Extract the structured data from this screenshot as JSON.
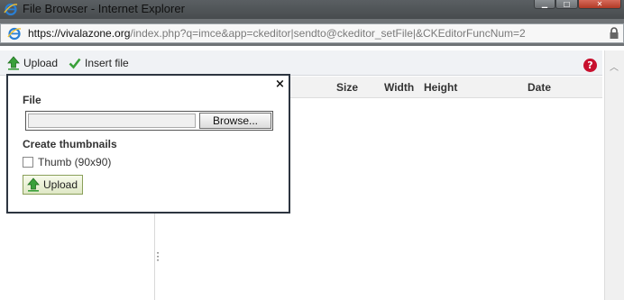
{
  "window": {
    "title": "File Browser - Internet Explorer",
    "minimize_glyph": "▁",
    "maximize_glyph": "□",
    "close_glyph": "✕"
  },
  "address": {
    "url_host": "https://vivalazone.org",
    "url_path": "/index.php?q=imce&app=ckeditor|sendto@ckeditor_setFile|&CKEditorFuncNum=2"
  },
  "toolbar": {
    "upload_label": "Upload",
    "insert_label": "Insert file",
    "help_glyph": "?"
  },
  "file_list": {
    "columns": [
      "Size",
      "Width",
      "Height",
      "Date"
    ]
  },
  "upload_panel": {
    "close_glyph": "×",
    "file_label": "File",
    "browse_label": "Browse...",
    "thumbnails_label": "Create thumbnails",
    "thumb_option_label": "Thumb (90x90)",
    "thumb_checked": false,
    "submit_label": "Upload"
  },
  "colors": {
    "upload_green": "#3aa03a",
    "help_red": "#c8102e",
    "panel_border": "#2d3540"
  }
}
